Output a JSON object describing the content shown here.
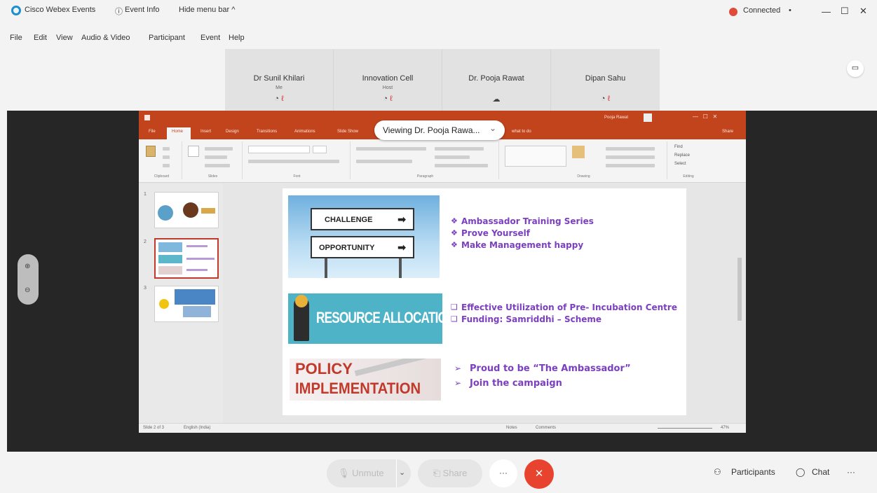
{
  "titlebar": {
    "app_title": "Cisco Webex Events",
    "event_info": "Event Info",
    "hide_menu": "Hide menu bar ^",
    "status": "Connected",
    "status_caret": "•",
    "minimize": "—",
    "maximize": "☐",
    "close": "✕"
  },
  "menu": [
    "File",
    "Edit",
    "View",
    "Audio & Video",
    "Participant",
    "Event",
    "Help"
  ],
  "participants": [
    {
      "name": "Dr Sunil Khilari",
      "role": "Me",
      "mic": true
    },
    {
      "name": "Innovation Cell",
      "role": "Host",
      "mic": true
    },
    {
      "name": "Dr. Pooja Rawat",
      "role": "",
      "mic": false
    },
    {
      "name": "Dipan Sahu",
      "role": "",
      "mic": true
    }
  ],
  "share": {
    "viewing_label": "Viewing Dr. Pooja Rawa...",
    "viewing_caret": "⌄"
  },
  "ppt": {
    "tabs": [
      "File",
      "Home",
      "Insert",
      "Design",
      "Transitions",
      "Animations",
      "Slide Show"
    ],
    "tell_me": "what to do",
    "user": "Pooja Rawat",
    "share_btn": "Share",
    "ribbon_groups": [
      "Clipboard",
      "Slides",
      "Font",
      "Paragraph",
      "Drawing",
      "Editing"
    ],
    "editing_items": [
      "Find",
      "Replace",
      "Select"
    ],
    "status_left": "Slide 2 of 3",
    "status_lang": "English (India)",
    "status_notes": "Notes",
    "status_comments": "Comments",
    "zoom": "47%",
    "thumb_numbers": [
      "1",
      "2",
      "3"
    ]
  },
  "slide": {
    "block1_img": {
      "line1": "CHALLENGE",
      "line2": "OPPORTUNITY"
    },
    "block1_bullets": [
      "Ambassador Training Series",
      "Prove Yourself",
      "Make Management happy"
    ],
    "block1_marker": "❖",
    "block2_img": "RESOURCE ALLOCATION",
    "block2_bullets": [
      "Effective Utilization of Pre- Incubation Centre",
      "Funding: Samriddhi – Scheme"
    ],
    "block2_marker": "❑",
    "block3_img": {
      "line1": "POLICY",
      "line2": "IMPLEMENTATION"
    },
    "block3_bullets": [
      "Proud to be  “The Ambassador”",
      "Join the campaign"
    ],
    "block3_marker": "➢"
  },
  "controls": {
    "unmute": "Unmute",
    "share": "Share",
    "more": "···",
    "end": "✕",
    "participants": "Participants",
    "chat": "Chat",
    "overflow": "···"
  },
  "colors": {
    "ppt_accent": "#c2441d",
    "bullet_purple": "#7b3fc0",
    "end_red": "#e8432e",
    "connected_red": "#e04a3a"
  }
}
